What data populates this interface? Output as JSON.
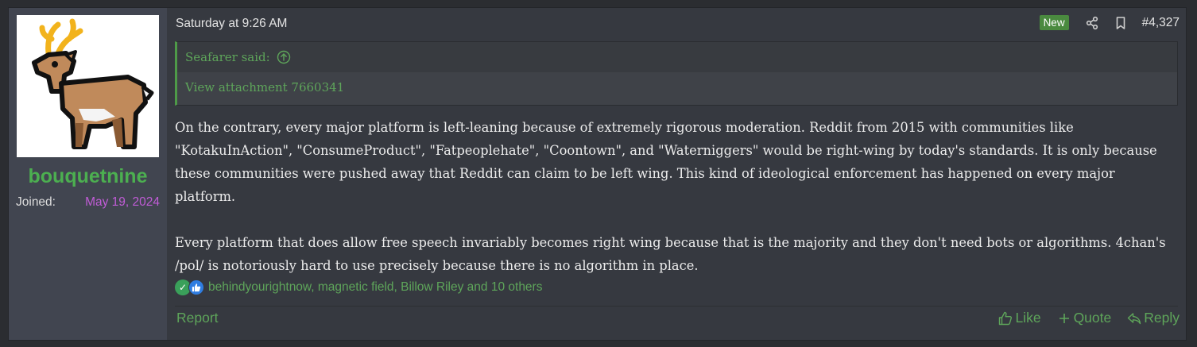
{
  "user": {
    "avatar_icon": "deer-icon",
    "name": "bouquetnine",
    "joined_label": "Joined:",
    "joined_date": "May 19, 2024"
  },
  "post": {
    "time": "Saturday at 9:26 AM",
    "badge": "New",
    "number": "#4,327",
    "quote": {
      "author": "Seafarer said:",
      "body": "View attachment 7660341"
    },
    "paragraphs": [
      "On the contrary, every major platform is left-leaning because of extremely rigorous moderation. Reddit from 2015 with communities like \"KotakuInAction\", \"ConsumeProduct\", \"Fatpeoplehate\", \"Coontown\", and \"Waterniggers\" would be right-wing by today's standards. It is only because these communities were pushed away that Reddit can claim to be left wing. This kind of ideological enforcement has happened on every major platform.",
      "Every platform that does allow free speech invariably becomes right wing because that is the majority and they don't need bots or algorithms. 4chan's /pol/ is notoriously hard to use precisely because there is no algorithm in place."
    ],
    "reactions": "behindyourightnow, magnetic field, Billow Riley and 10 others"
  },
  "footer": {
    "report": "Report",
    "like": "Like",
    "quote": "Quote",
    "reply": "Reply"
  },
  "colors": {
    "accent_green": "#5ea55a",
    "username_green": "#4caf50",
    "joined_date_purple": "#c05cd6",
    "badge_green": "#4a8a3f"
  }
}
